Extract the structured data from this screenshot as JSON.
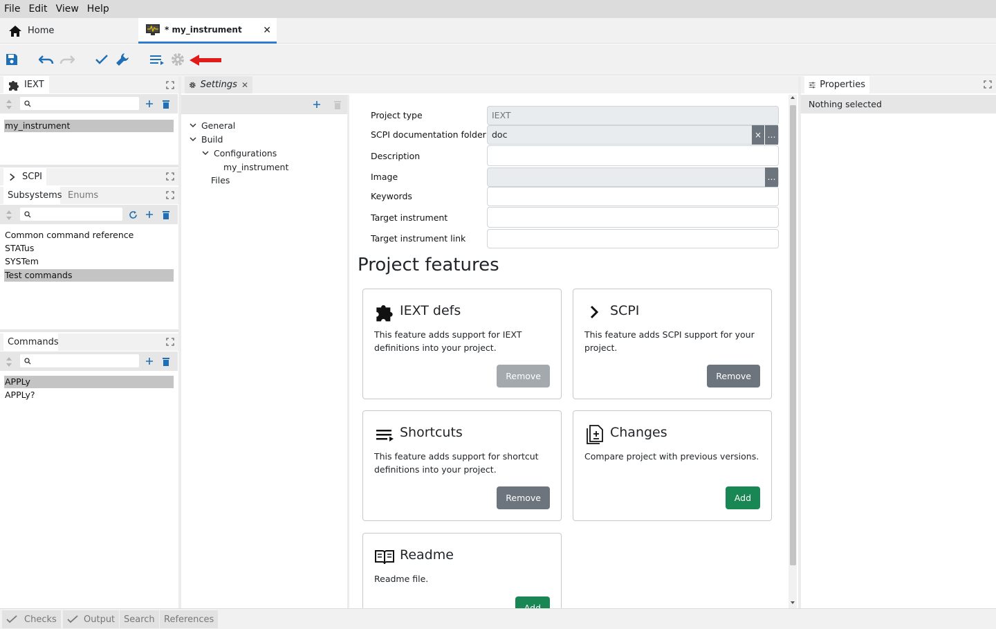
{
  "menu": [
    "File",
    "Edit",
    "View",
    "Help"
  ],
  "tabs": {
    "home": "Home",
    "project": "* my_instrument"
  },
  "left": {
    "iext_tab": "IEXT",
    "iext_items": [
      "my_instrument"
    ],
    "scpi_tab": "SCPI",
    "subsystems_tab": "Subsystems",
    "enums_tab": "Enums",
    "subsystem_items": [
      "Common command reference",
      "STATus",
      "SYSTem",
      "Test commands"
    ],
    "commands_tab": "Commands",
    "command_items": [
      "APPLy",
      "APPLy?"
    ]
  },
  "middle": {
    "settings_tab": "Settings",
    "tree": {
      "general": "General",
      "build": "Build",
      "configurations": "Configurations",
      "config_item": "my_instrument",
      "files": "Files"
    }
  },
  "form": {
    "project_type_label": "Project type",
    "project_type_value": "IEXT",
    "scpi_doc_label": "SCPI documentation folder",
    "scpi_doc_value": "doc",
    "description_label": "Description",
    "image_label": "Image",
    "keywords_label": "Keywords",
    "target_instrument_label": "Target instrument",
    "target_instrument_link_label": "Target instrument link",
    "browse_label": "…",
    "clear_label": "×"
  },
  "features": {
    "title": "Project features",
    "cards": [
      {
        "title": "IEXT defs",
        "desc": "This feature adds support for IEXT definitions into your project.",
        "button": "Remove"
      },
      {
        "title": "SCPI",
        "desc": "This feature adds SCPI support for your project.",
        "button": "Remove"
      },
      {
        "title": "Shortcuts",
        "desc": "This feature adds support for shortcut definitions into your project.",
        "button": "Remove"
      },
      {
        "title": "Changes",
        "desc": "Compare project with previous versions.",
        "button": "Add"
      },
      {
        "title": "Readme",
        "desc": "Readme file.",
        "button": "Add"
      }
    ]
  },
  "properties": {
    "tab": "Properties",
    "empty": "Nothing selected"
  },
  "bottom": {
    "checks": "Checks",
    "output": "Output",
    "search": "Search",
    "references": "References"
  },
  "colors": {
    "accent": "#2e7bcf",
    "icon_blue": "#1f6fb5",
    "remove_button": "#6c757d",
    "add_button": "#198754",
    "arrow_red": "#e01b1b"
  }
}
